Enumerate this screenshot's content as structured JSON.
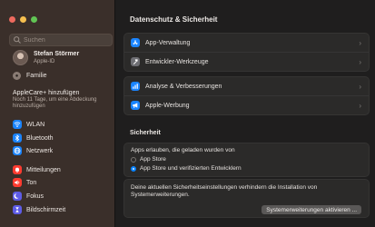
{
  "sidebar": {
    "search_placeholder": "Suchen",
    "user": {
      "name": "Stefan Störmer",
      "subtitle": "Apple-ID"
    },
    "family_label": "Familie",
    "applecare": {
      "title": "AppleCare+ hinzufügen",
      "description": "Noch 11 Tage, um eine Abdeckung hinzuzufügen"
    },
    "items": [
      {
        "label": "WLAN",
        "icon": "wifi-icon",
        "color": "#1a84ff"
      },
      {
        "label": "Bluetooth",
        "icon": "bluetooth-icon",
        "color": "#1a84ff"
      },
      {
        "label": "Netzwerk",
        "icon": "globe-icon",
        "color": "#1a84ff"
      },
      {
        "label": "Mitteilungen",
        "icon": "bell-icon",
        "color": "#ff3b30"
      },
      {
        "label": "Ton",
        "icon": "speaker-icon",
        "color": "#ff3b30"
      },
      {
        "label": "Fokus",
        "icon": "moon-icon",
        "color": "#5e5ce6"
      },
      {
        "label": "Bildschirmzeit",
        "icon": "hourglass-icon",
        "color": "#5e5ce6"
      }
    ]
  },
  "main": {
    "title": "Datenschutz & Sicherheit",
    "group1": [
      {
        "label": "App-Verwaltung",
        "icon": "app-store-icon",
        "color": "#1a84ff"
      },
      {
        "label": "Entwickler-Werkzeuge",
        "icon": "hammer-icon",
        "color": "#6e6e73"
      }
    ],
    "group2": [
      {
        "label": "Analyse & Verbesserungen",
        "icon": "chart-icon",
        "color": "#1a84ff"
      },
      {
        "label": "Apple-Werbung",
        "icon": "megaphone-icon",
        "color": "#1a84ff"
      }
    ],
    "security": {
      "heading": "Sicherheit",
      "question": "Apps erlauben, die geladen wurden von",
      "options": [
        "App Store",
        "App Store und verifizierten Entwicklern"
      ],
      "selected_option": "App Store und verifizierten Entwicklern",
      "extension_message": "Deine aktuellen Sicherheitseinstellungen verhindern die Installation von Systemerweiterungen.",
      "extension_button": "Systemerweiterungen aktivieren ..."
    }
  }
}
